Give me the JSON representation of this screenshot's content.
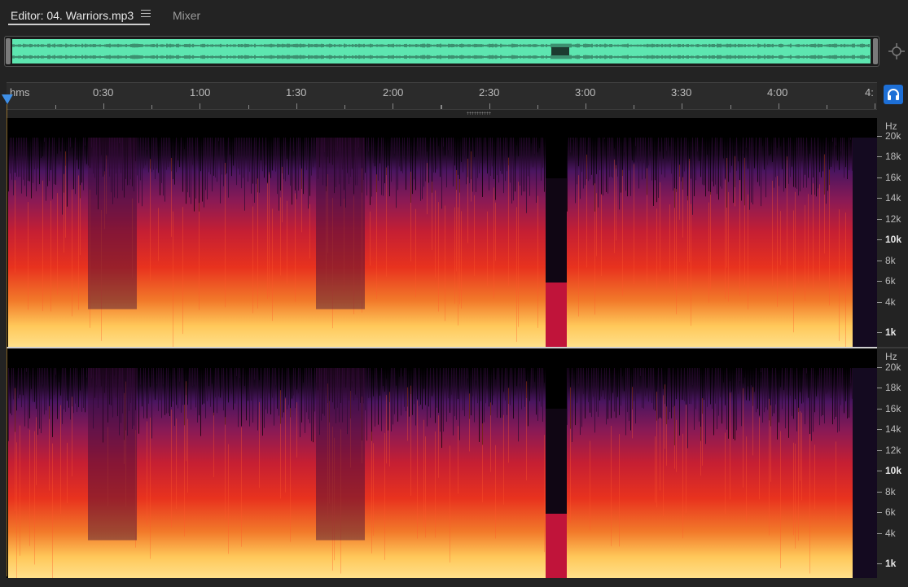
{
  "tabs": {
    "editor_label": "Editor: 04. Warriors.mp3",
    "mixer_label": "Mixer"
  },
  "ruler": {
    "unit_label": "hms",
    "labels": [
      "0:30",
      "1:00",
      "1:30",
      "2:00",
      "2:30",
      "3:00",
      "3:30",
      "4:00",
      "4:"
    ]
  },
  "freq_scale": {
    "unit": "Hz",
    "labels": [
      "20k",
      "18k",
      "16k",
      "14k",
      "12k",
      "10k",
      "8k",
      "6k",
      "4k",
      "1k"
    ]
  },
  "colors": {
    "overview_waveform": "#5de6b0",
    "playhead": "#3f8fe6",
    "monitor_button": "#1d6fd6",
    "spectrum_low": "#ffd36a",
    "spectrum_mid": "#e8321e",
    "spectrum_high": "#5a1a5e"
  },
  "icons": {
    "tab_menu": "hamburger-icon",
    "zoom_nav": "zoom-navigator-icon",
    "monitor": "headphones-icon"
  }
}
